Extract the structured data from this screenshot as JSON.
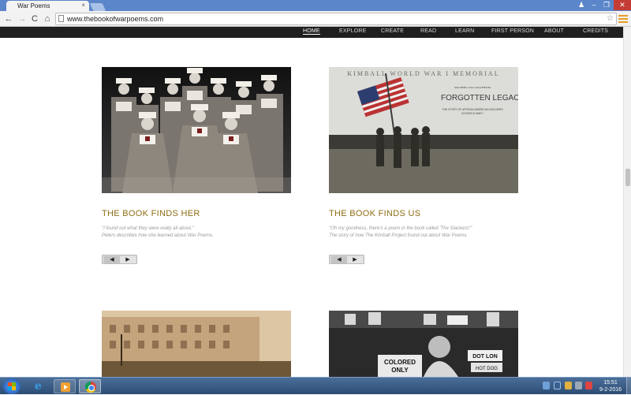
{
  "browser": {
    "tab_title": "War Poems",
    "tab_close": "×",
    "url": "www.thebookofwarpoems.com",
    "back_glyph": "←",
    "forward_glyph": "→",
    "reload_glyph": "C",
    "home_glyph": "⌂",
    "star_glyph": "☆",
    "window_controls": {
      "user": "♟",
      "minimize": "–",
      "maximize": "❐",
      "close": "✕"
    }
  },
  "nav": {
    "items": [
      {
        "label": "HOME",
        "active": true
      },
      {
        "label": "EXPLORE"
      },
      {
        "label": "CREATE"
      },
      {
        "label": "READ"
      },
      {
        "label": "LEARN"
      },
      {
        "label": "FIRST PERSON"
      },
      {
        "label": "ABOUT"
      },
      {
        "label": "CREDITS"
      }
    ]
  },
  "cards": [
    {
      "title": "THE BOOK FINDS HER",
      "quote": "\"I found out what they were really all about.\"",
      "description": "Peters describes how she learned about War Poems.",
      "image": "photo of WWI nurses in uniform"
    },
    {
      "title": "THE BOOK FINDS US",
      "quote": "\"Oh my goodness, there's a poem in the book called 'The Slackers!'\"",
      "description": "The story of how The Kimball Project found out about War Poems.",
      "image_heading": "KIMBALL WORLD WAR I MEMORIAL",
      "image_kicker": "SOLDIERS of the COALFIELDS",
      "image_title": "FORGOTTEN LEGACY",
      "image_subtitle_1": "THE STORY OF AFRICAN AMERICAN SOLDIERS",
      "image_subtitle_2": "IN WORLD WAR I"
    },
    {
      "image": "sepia photo of crowd in front of a building"
    },
    {
      "image": "photo of a shop window with signs",
      "sign_1": "COLORED",
      "sign_2": "ONLY",
      "sign_3": "DOT LON",
      "sign_4": "HOT DOG"
    }
  ],
  "player": {
    "prev": "◀",
    "next": "▶"
  },
  "taskbar": {
    "time": "15:51",
    "date": "9-2-2016",
    "ie_glyph": "e"
  }
}
